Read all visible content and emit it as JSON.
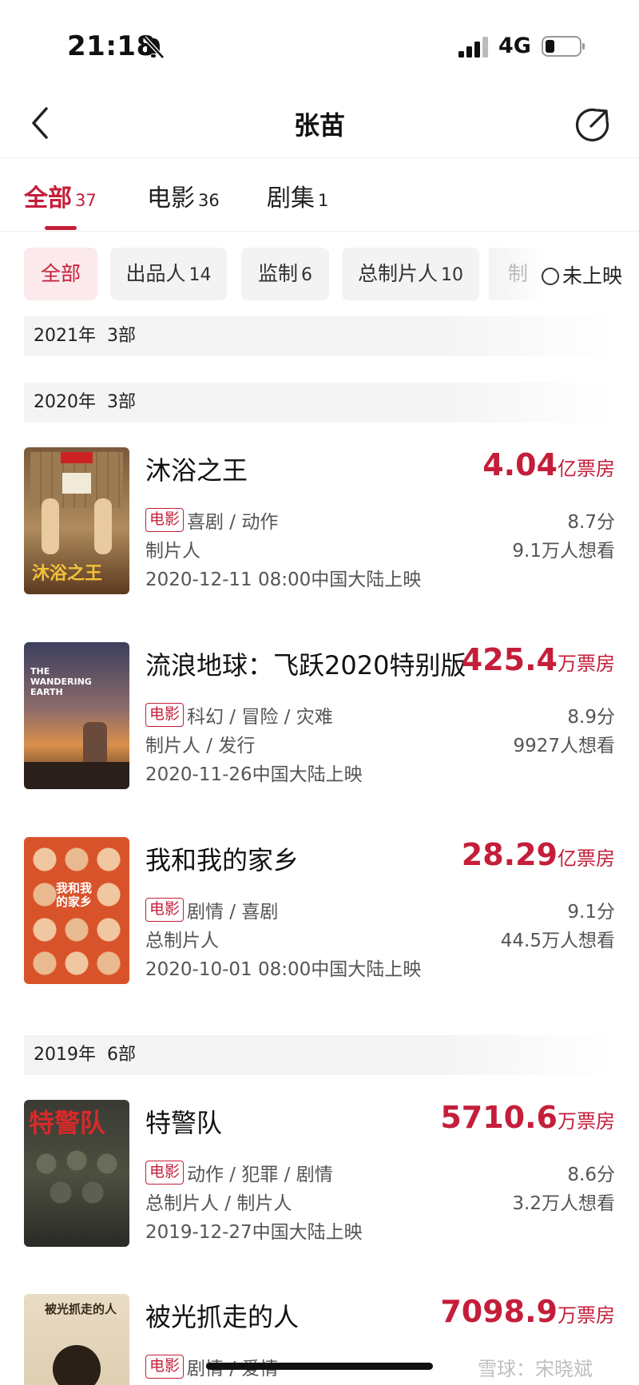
{
  "status_bar": {
    "time": "21:18",
    "network": "4G"
  },
  "nav": {
    "title": "张苗"
  },
  "main_tabs": [
    {
      "label": "全部",
      "count": "37"
    },
    {
      "label": "电影",
      "count": "36"
    },
    {
      "label": "剧集",
      "count": "1"
    }
  ],
  "filters": {
    "chips": [
      {
        "label": "全部",
        "count": ""
      },
      {
        "label": "出品人",
        "count": "14"
      },
      {
        "label": "监制",
        "count": "6"
      },
      {
        "label": "总制片人",
        "count": "10"
      }
    ],
    "partial_chip": "制",
    "unreleased_label": "未上映"
  },
  "years": [
    {
      "label": "2021年",
      "count": "3部"
    },
    {
      "label": "2020年",
      "count": "3部"
    },
    {
      "label": "2019年",
      "count": "6部"
    }
  ],
  "movies": [
    {
      "title": "沐浴之王",
      "box_value": "4.04",
      "box_unit": "亿票房",
      "tag": "电影",
      "genres": "喜剧 / 动作",
      "score": "8.7分",
      "role": "制片人",
      "want": "9.1万人想看",
      "date": "2020-12-11 08:00中国大陆上映",
      "poster_text": "沐浴之王"
    },
    {
      "title": "流浪地球：飞跃2020特别版",
      "box_value": "425.4",
      "box_unit": "万票房",
      "tag": "电影",
      "genres": "科幻 / 冒险 / 灾难",
      "score": "8.9分",
      "role": "制片人 / 发行",
      "want": "9927人想看",
      "date": "2020-11-26中国大陆上映",
      "poster_text": "THE WANDERING EARTH"
    },
    {
      "title": "我和我的家乡",
      "box_value": "28.29",
      "box_unit": "亿票房",
      "tag": "电影",
      "genres": "剧情 / 喜剧",
      "score": "9.1分",
      "role": "总制片人",
      "want": "44.5万人想看",
      "date": "2020-10-01 08:00中国大陆上映",
      "poster_text": "我和我的家乡"
    },
    {
      "title": "特警队",
      "box_value": "5710.6",
      "box_unit": "万票房",
      "tag": "电影",
      "genres": "动作 / 犯罪 / 剧情",
      "score": "8.6分",
      "role": "总制片人 / 制片人",
      "want": "3.2万人想看",
      "date": "2019-12-27中国大陆上映",
      "poster_text": "特警队"
    },
    {
      "title": "被光抓走的人",
      "box_value": "7098.9",
      "box_unit": "万票房",
      "tag": "电影",
      "genres": "剧情 / 爱情",
      "poster_text": "被光抓走的人"
    }
  ],
  "watermark": "雪球：宋晓斌"
}
